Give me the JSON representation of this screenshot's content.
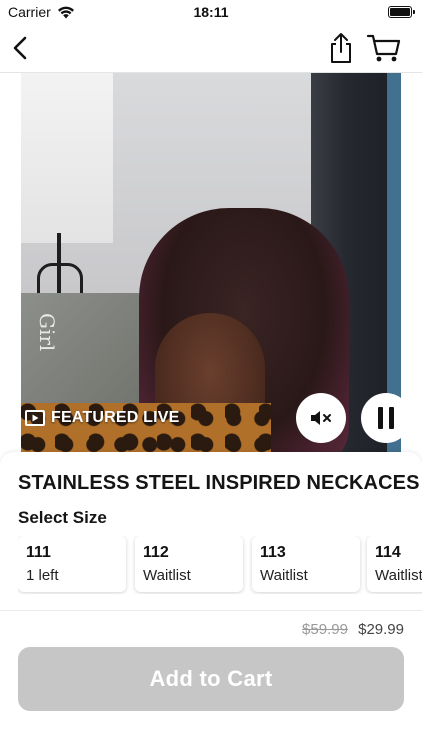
{
  "status_bar": {
    "carrier": "Carrier",
    "time": "18:11",
    "wifi_icon": "wifi-icon",
    "battery_icon": "battery-icon"
  },
  "nav": {
    "back_icon": "back-chevron-icon",
    "share_icon": "share-icon",
    "cart_icon": "cart-icon"
  },
  "video": {
    "featured_label": "FEATURED LIVE",
    "featured_icon": "play-rectangle-icon",
    "mute_icon": "speaker-mute-icon",
    "pause_icon": "pause-icon",
    "background_text": "Girl"
  },
  "product": {
    "title": "STAINLESS STEEL INSPIRED NECKACES",
    "select_size_label": "Select Size",
    "sizes": [
      {
        "name": "111",
        "status": "1 left"
      },
      {
        "name": "112",
        "status": "Waitlist"
      },
      {
        "name": "113",
        "status": "Waitlist"
      },
      {
        "name": "114",
        "status": "Waitlist"
      }
    ]
  },
  "footer": {
    "old_price": "$59.99",
    "new_price": "$29.99",
    "add_to_cart_label": "Add to Cart",
    "button_color": "#c6c6c6"
  }
}
